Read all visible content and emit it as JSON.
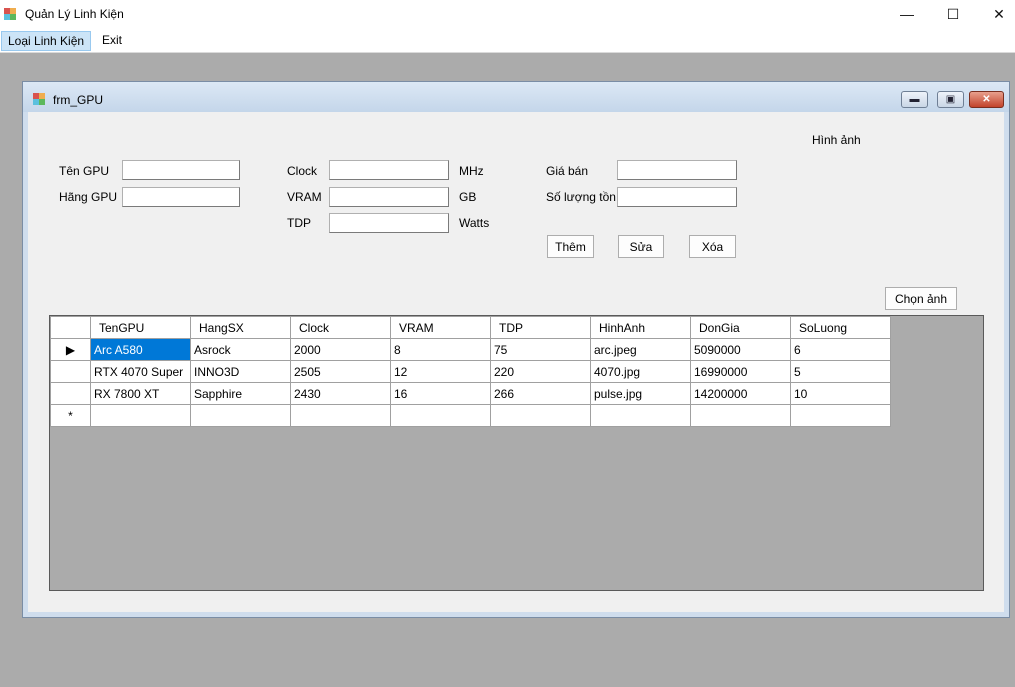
{
  "window": {
    "title": "Quản Lý Linh Kiện"
  },
  "menu": {
    "items": [
      "Loại Linh Kiện",
      "Exit"
    ]
  },
  "child": {
    "title": "frm_GPU"
  },
  "form": {
    "ten_gpu_label": "Tên GPU",
    "hang_gpu_label": "Hãng GPU",
    "clock_label": "Clock",
    "clock_unit": "MHz",
    "vram_label": "VRAM",
    "vram_unit": "GB",
    "tdp_label": "TDP",
    "tdp_unit": "Watts",
    "gia_ban_label": "Giá bán",
    "so_luong_label": "Số lượng tồn",
    "hinh_anh_label": "Hình ảnh",
    "them_button": "Thêm",
    "sua_button": "Sửa",
    "xoa_button": "Xóa",
    "chon_anh_button": "Chọn ảnh",
    "values": {
      "ten_gpu": "",
      "hang_gpu": "",
      "clock": "",
      "vram": "",
      "tdp": "",
      "gia_ban": "",
      "so_luong": ""
    }
  },
  "grid": {
    "columns": [
      "TenGPU",
      "HangSX",
      "Clock",
      "VRAM",
      "TDP",
      "HinhAnh",
      "DonGia",
      "SoLuong"
    ],
    "rows": [
      [
        "Arc A580",
        "Asrock",
        "2000",
        "8",
        "75",
        "arc.jpeg",
        "5090000",
        "6"
      ],
      [
        "RTX 4070 Super",
        "INNO3D",
        "2505",
        "12",
        "220",
        "4070.jpg",
        "16990000",
        "5"
      ],
      [
        "RX 7800 XT",
        "Sapphire",
        "2430",
        "16",
        "266",
        "pulse.jpg",
        "14200000",
        "10"
      ]
    ],
    "current_row_marker": "▶",
    "new_row_marker": "*"
  }
}
